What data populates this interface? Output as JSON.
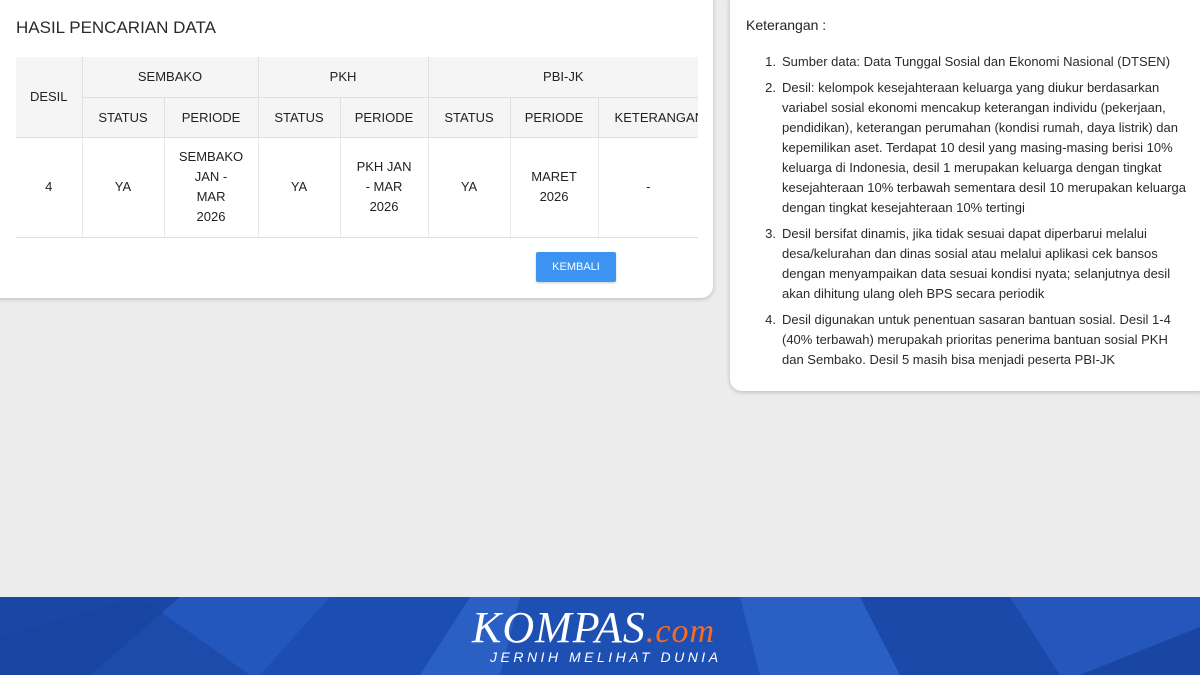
{
  "results": {
    "title": "HASIL PENCARIAN DATA",
    "headers": {
      "desil": "DESIL",
      "sembako": "SEMBAKO",
      "pkh": "PKH",
      "pbijk": "PBI-JK",
      "status": "STATUS",
      "periode": "PERIODE",
      "keterangan": "KETERANGAN"
    },
    "row": {
      "desil": "4",
      "sembako_status": "YA",
      "sembako_periode": [
        "SEMBAKO",
        "JAN -",
        "MAR",
        "2026"
      ],
      "pkh_status": "YA",
      "pkh_periode": [
        "PKH JAN",
        "- MAR",
        "2026"
      ],
      "pbijk_status": "YA",
      "pbijk_periode": [
        "MARET",
        "2026"
      ],
      "keterangan": "-"
    },
    "back_button": "KEMBALI"
  },
  "notes": {
    "title": "Keterangan :",
    "items": [
      {
        "num": "1.",
        "text": "Sumber data: Data Tunggal Sosial dan Ekonomi Nasional (DTSEN)"
      },
      {
        "num": "2.",
        "text": "Desil: kelompok kesejahteraan keluarga yang diukur berdasarkan variabel sosial ekonomi mencakup keterangan individu (pekerjaan, pendidikan), keterangan perumahan (kondisi rumah, daya listrik) dan kepemilikan aset. Terdapat 10 desil yang masing-masing berisi 10% keluarga di Indonesia, desil 1 merupakan keluarga dengan tingkat kesejahteraan 10% terbawah sementara desil 10 merupakan keluarga dengan tingkat kesejahteraan 10% tertingi"
      },
      {
        "num": "3.",
        "text": "Desil bersifat dinamis, jika tidak sesuai dapat diperbarui melalui desa/kelurahan dan dinas sosial atau melalui aplikasi cek bansos dengan menyampaikan data sesuai kondisi nyata; selanjutnya desil akan dihitung ulang oleh BPS secara periodik"
      },
      {
        "num": "4.",
        "text": "Desil digunakan untuk penentuan sasaran bantuan sosial. Desil 1-4 (40% terbawah) merupakah prioritas penerima bantuan sosial PKH dan Sembako. Desil 5 masih bisa menjadi peserta PBI-JK"
      }
    ]
  },
  "branding": {
    "name": "KOMPAS",
    "suffix": ".com",
    "tagline": "JERNIH MELIHAT DUNIA",
    "colors": {
      "footer": "#1e4fb3",
      "accent": "#ff6a1f",
      "button": "#3c93f2"
    }
  }
}
